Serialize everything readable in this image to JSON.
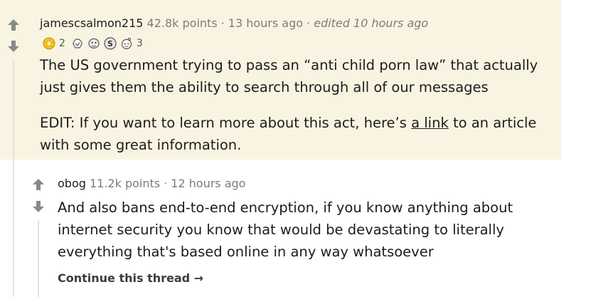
{
  "parent_comment": {
    "author": "jamescsalmon215",
    "points": "42.8k points",
    "separator": "·",
    "time": "13 hours ago",
    "edited": "edited 10 hours ago",
    "awards": [
      {
        "icon": "gold-star-award-icon",
        "count": "2"
      },
      {
        "icon": "wholesome-hands-award-icon",
        "count": ""
      },
      {
        "icon": "helpful-face-award-icon",
        "count": ""
      },
      {
        "icon": "silver-s-award-icon",
        "count": ""
      },
      {
        "icon": "snoo-face-award-icon",
        "count": "3"
      }
    ],
    "line1": "The US government trying to pass an “anti child porn law” that actually",
    "line2": "just gives them the ability to search through all of our messages",
    "edit_prefix": "EDIT: If you want to learn more about this act, here’s ",
    "link_text": "a link",
    "edit_suffix": " to an article",
    "edit_line2": "with some great information.",
    "bg_color": "#f9f4e2"
  },
  "reply_comment": {
    "author": "obog",
    "points": "11.2k points",
    "separator": "·",
    "time": "12 hours ago",
    "line1": "And also bans end-to-end encryption, if you know anything about",
    "line2": "internet security you know that would be devastating to literally",
    "line3": "everything that's based online in any way whatsoever"
  },
  "continue_thread": "Continue this thread →",
  "colors": {
    "arrow": "#878a8c",
    "meta": "#7c7c7c",
    "text": "#1c1c1c"
  }
}
